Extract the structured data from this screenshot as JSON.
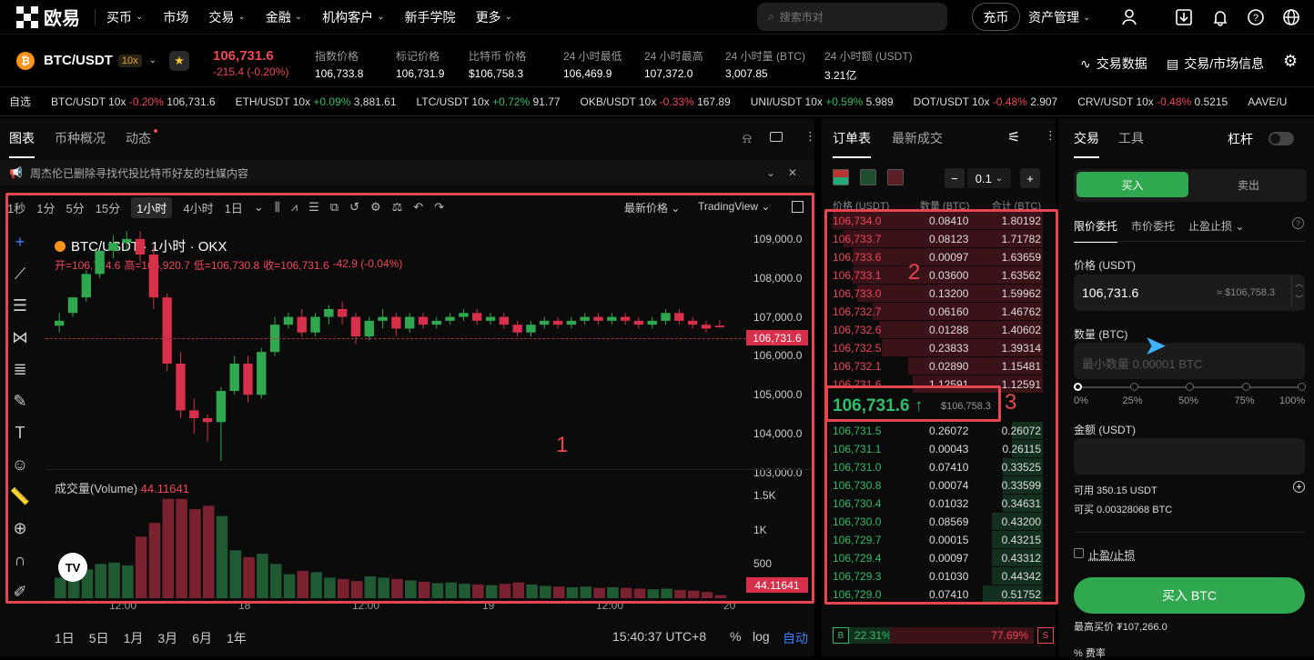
{
  "nav": {
    "brand": "欧易",
    "items": [
      "买币",
      "市场",
      "交易",
      "金融",
      "机构客户",
      "新手学院",
      "更多"
    ],
    "search_placeholder": "搜索市对",
    "charge": "充币",
    "asset": "资产管理"
  },
  "ticker": {
    "pair": "BTC/USDT",
    "lev": "10x",
    "price": "106,731.6",
    "change": "-215.4 (-0.20%)",
    "stats": [
      {
        "l": "指数价格",
        "v": "106,733.8"
      },
      {
        "l": "标记价格",
        "v": "106,731.9"
      },
      {
        "l": "比特币 价格",
        "v": "$106,758.3"
      },
      {
        "l": "24 小时最低",
        "v": "106,469.9"
      },
      {
        "l": "24 小时最高",
        "v": "107,372.0"
      },
      {
        "l": "24 小时量 (BTC)",
        "v": "3,007.85"
      },
      {
        "l": "24 小时额 (USDT)",
        "v": "3.21亿"
      }
    ],
    "tools": [
      "交易数据",
      "交易/市场信息"
    ]
  },
  "marquee": {
    "label": "自选",
    "items": [
      {
        "p": "BTC/USDT 10x",
        "c": "-0.20%",
        "v": "106,731.6",
        "d": "dn"
      },
      {
        "p": "ETH/USDT 10x",
        "c": "+0.09%",
        "v": "3,881.61",
        "d": "up"
      },
      {
        "p": "LTC/USDT 10x",
        "c": "+0.72%",
        "v": "91.77",
        "d": "up"
      },
      {
        "p": "OKB/USDT 10x",
        "c": "-0.33%",
        "v": "167.89",
        "d": "dn"
      },
      {
        "p": "UNI/USDT 10x",
        "c": "+0.59%",
        "v": "5.989",
        "d": "up"
      },
      {
        "p": "DOT/USDT 10x",
        "c": "-0.48%",
        "v": "2.907",
        "d": "dn"
      },
      {
        "p": "CRV/USDT 10x",
        "c": "-0.48%",
        "v": "0.5215",
        "d": "dn"
      },
      {
        "p": "AAVE/U",
        "c": "",
        "v": "",
        "d": "dn"
      }
    ]
  },
  "chart_panel": {
    "tabs": [
      "图表",
      "币种概况",
      "动态"
    ],
    "notice": "周杰伦已删除寻找代投比特币好友的社媒内容",
    "intervals": [
      "1秒",
      "1分",
      "5分",
      "15分",
      "1小时",
      "4小时",
      "1日"
    ],
    "selected": "1小时",
    "latest": "最新价格",
    "tv": "TradingView",
    "title": "BTC/USDT · 1小时 · OKX",
    "ohlc": {
      "o": "开=106,774.6",
      "h": "高=106,920.7",
      "l": "低=106,730.8",
      "c": "收=106,731.6",
      "chg": "-42.9 (-0.04%)"
    },
    "vol_label": "成交量(Volume)",
    "vol_value": "44.11641",
    "price_axis": [
      "109,000.0",
      "108,000.0",
      "107,000.0",
      "106,000.0",
      "105,000.0",
      "104,000.0",
      "103,000.0"
    ],
    "vol_axis": [
      "1.5K",
      "1K",
      "500"
    ],
    "time_axis": [
      "12:00",
      "18",
      "12:00",
      "19",
      "12:00",
      "20"
    ],
    "last_price": "106,731.6",
    "last_vol": "44.11641",
    "ranges": [
      "1日",
      "5日",
      "1月",
      "3月",
      "6月",
      "1年"
    ],
    "clock": "15:40:37 UTC+8",
    "pct": "%",
    "log": "log",
    "auto": "自动",
    "box1": "1",
    "box2": "2",
    "box3": "3"
  },
  "chart_data": {
    "type": "candlestick",
    "ylim": [
      103000,
      109300
    ],
    "candles": [
      [
        106774,
        107100,
        106900,
        106600
      ],
      [
        107100,
        107500,
        107500,
        107000
      ],
      [
        107500,
        108200,
        108100,
        107400
      ],
      [
        108100,
        108700,
        108700,
        108000
      ],
      [
        108700,
        109100,
        108900,
        108500
      ],
      [
        108900,
        109200,
        109000,
        108700
      ],
      [
        109000,
        109200,
        108600,
        108400
      ],
      [
        108600,
        108800,
        107500,
        107200
      ],
      [
        107500,
        107600,
        105800,
        105600
      ],
      [
        105800,
        106100,
        104600,
        104400
      ],
      [
        104600,
        104900,
        104400,
        104000
      ],
      [
        104400,
        104500,
        104300,
        103800
      ],
      [
        104300,
        105200,
        105100,
        103300
      ],
      [
        105100,
        106000,
        105800,
        105000
      ],
      [
        105800,
        106000,
        105000,
        104800
      ],
      [
        105000,
        106200,
        106100,
        104900
      ],
      [
        106100,
        107000,
        106800,
        106000
      ],
      [
        106800,
        107100,
        107000,
        106700
      ],
      [
        107000,
        107200,
        106600,
        106500
      ],
      [
        106600,
        107100,
        107000,
        106500
      ],
      [
        107000,
        107300,
        107200,
        106800
      ],
      [
        107200,
        107400,
        107000,
        106800
      ],
      [
        107000,
        107100,
        106500,
        106300
      ],
      [
        106500,
        107000,
        106900,
        106400
      ],
      [
        106900,
        107200,
        107000,
        106700
      ],
      [
        107000,
        107100,
        106700,
        106500
      ],
      [
        106700,
        107100,
        107000,
        106600
      ],
      [
        107000,
        107100,
        106800,
        106700
      ],
      [
        106800,
        107000,
        106900,
        106700
      ],
      [
        106900,
        107100,
        107000,
        106800
      ],
      [
        107000,
        107200,
        107100,
        106900
      ],
      [
        107100,
        107200,
        106900,
        106800
      ],
      [
        106900,
        107100,
        107000,
        106800
      ],
      [
        107000,
        107100,
        106800,
        106700
      ],
      [
        106800,
        106900,
        106600,
        106500
      ],
      [
        106600,
        106900,
        106800,
        106500
      ],
      [
        106800,
        107000,
        106900,
        106700
      ],
      [
        106900,
        107000,
        106800,
        106700
      ],
      [
        106800,
        107000,
        106900,
        106700
      ],
      [
        106900,
        107100,
        107000,
        106800
      ],
      [
        107000,
        107100,
        106900,
        106800
      ],
      [
        106900,
        107100,
        107000,
        106800
      ],
      [
        107000,
        107100,
        106900,
        106800
      ],
      [
        106900,
        107000,
        106800,
        106700
      ],
      [
        106800,
        107000,
        106900,
        106700
      ],
      [
        106900,
        107200,
        107100,
        106800
      ],
      [
        107100,
        107200,
        106900,
        106800
      ],
      [
        106900,
        107000,
        106800,
        106700
      ],
      [
        106800,
        106900,
        106700,
        106600
      ],
      [
        106774,
        106920,
        106731,
        106730
      ]
    ],
    "volume": [
      300,
      350,
      420,
      500,
      520,
      480,
      900,
      1100,
      1450,
      1450,
      1300,
      1350,
      1200,
      700,
      600,
      650,
      500,
      350,
      400,
      380,
      300,
      280,
      250,
      320,
      300,
      280,
      260,
      240,
      220,
      230,
      210,
      200,
      190,
      210,
      230,
      200,
      180,
      170,
      160,
      170,
      150,
      160,
      150,
      140,
      130,
      140,
      120,
      110,
      90,
      44
    ]
  },
  "orderbook": {
    "tabs": [
      "订单表",
      "最新成交"
    ],
    "step": "0.1",
    "headers": [
      "价格 (USDT)",
      "数量 (BTC)",
      "合计 (BTC)"
    ],
    "asks": [
      [
        "106,734.0",
        "0.08410",
        "1.80192",
        0.95
      ],
      [
        "106,733.7",
        "0.08123",
        "1.71782",
        0.9
      ],
      [
        "106,733.6",
        "0.00097",
        "1.63659",
        0.86
      ],
      [
        "106,733.1",
        "0.03600",
        "1.63562",
        0.86
      ],
      [
        "106,733.0",
        "0.13200",
        "1.59962",
        0.84
      ],
      [
        "106,732.7",
        "0.06160",
        "1.46762",
        0.77
      ],
      [
        "106,732.6",
        "0.01288",
        "1.40602",
        0.74
      ],
      [
        "106,732.5",
        "0.23833",
        "1.39314",
        0.73
      ],
      [
        "106,732.1",
        "0.02890",
        "1.15481",
        0.61
      ],
      [
        "106,731.6",
        "1.12591",
        "1.12591",
        0.59
      ]
    ],
    "mid": "106,731.6",
    "mid_arrow": "↑",
    "mid_usd": "$106,758.3",
    "bids": [
      [
        "106,731.5",
        "0.26072",
        "0.26072",
        0.14
      ],
      [
        "106,731.1",
        "0.00043",
        "0.26115",
        0.14
      ],
      [
        "106,731.0",
        "0.07410",
        "0.33525",
        0.18
      ],
      [
        "106,730.8",
        "0.00074",
        "0.33599",
        0.18
      ],
      [
        "106,730.4",
        "0.01032",
        "0.34631",
        0.18
      ],
      [
        "106,730.0",
        "0.08569",
        "0.43200",
        0.23
      ],
      [
        "106,729.7",
        "0.00015",
        "0.43215",
        0.23
      ],
      [
        "106,729.4",
        "0.00097",
        "0.43312",
        0.23
      ],
      [
        "106,729.3",
        "0.01030",
        "0.44342",
        0.23
      ],
      [
        "106,729.0",
        "0.07410",
        "0.51752",
        0.27
      ]
    ],
    "buy_pct": "22.31%",
    "sell_pct": "77.69%",
    "b": "B",
    "s": "S"
  },
  "trade": {
    "tabs": [
      "交易",
      "工具"
    ],
    "leverage": "杠杆",
    "buy": "买入",
    "sell": "卖出",
    "order_types": [
      "限价委托",
      "市价委托",
      "止盈止损"
    ],
    "price_label": "价格 (USDT)",
    "price_value": "106,731.6",
    "price_usd": "≈ $106,758.3",
    "qty_label": "数量 (BTC)",
    "qty_placeholder": "最小数量 0.00001 BTC",
    "slider": [
      "0%",
      "25%",
      "50%",
      "75%",
      "100%"
    ],
    "amount_label": "金额 (USDT)",
    "avail": "可用 350.15 USDT",
    "can_buy": "可买 0.00328068 BTC",
    "tpsl": "止盈/止损",
    "buy_btn": "买入 BTC",
    "max_buy": "最高买价 ₮107,266.0",
    "fee": "费率"
  }
}
